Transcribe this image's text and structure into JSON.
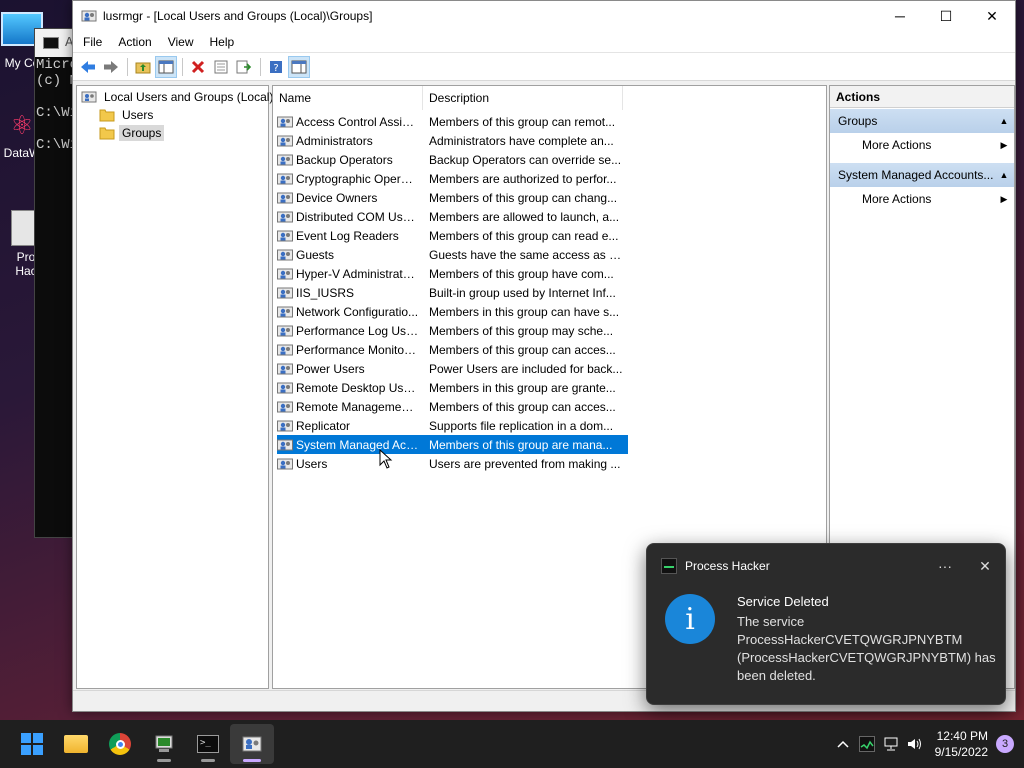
{
  "desktop": {
    "icons": [
      {
        "label": "My Co"
      },
      {
        "label": "DataW"
      },
      {
        "label": "Pro\nHac"
      }
    ]
  },
  "console": {
    "title": "A",
    "lines": [
      "Micro",
      "(c) M",
      "",
      "C:\\Wi",
      "",
      "C:\\Wi"
    ]
  },
  "window": {
    "title": "lusrmgr - [Local Users and Groups (Local)\\Groups]",
    "minimize": "─",
    "maximize": "☐",
    "close": "✕"
  },
  "menu": [
    "File",
    "Action",
    "View",
    "Help"
  ],
  "toolbar": {
    "icons": [
      "back-icon",
      "forward-icon",
      "up-folder-icon",
      "show-hide-tree-icon",
      "delete-icon",
      "properties-icon",
      "export-icon",
      "help-icon",
      "action-pane-icon"
    ]
  },
  "tree": {
    "root": "Local Users and Groups (Local)",
    "children": [
      "Users",
      "Groups"
    ],
    "selected": "Groups"
  },
  "list": {
    "columns": [
      "Name",
      "Description"
    ],
    "rows": [
      {
        "name": "Access Control Assist...",
        "desc": "Members of this group can remot..."
      },
      {
        "name": "Administrators",
        "desc": "Administrators have complete an..."
      },
      {
        "name": "Backup Operators",
        "desc": "Backup Operators can override se..."
      },
      {
        "name": "Cryptographic Operat...",
        "desc": "Members are authorized to perfor..."
      },
      {
        "name": "Device Owners",
        "desc": "Members of this group can chang..."
      },
      {
        "name": "Distributed COM Users",
        "desc": "Members are allowed to launch, a..."
      },
      {
        "name": "Event Log Readers",
        "desc": "Members of this group can read e..."
      },
      {
        "name": "Guests",
        "desc": "Guests have the same access as m..."
      },
      {
        "name": "Hyper-V Administrators",
        "desc": "Members of this group have com..."
      },
      {
        "name": "IIS_IUSRS",
        "desc": "Built-in group used by Internet Inf..."
      },
      {
        "name": "Network Configuratio...",
        "desc": "Members in this group can have s..."
      },
      {
        "name": "Performance Log Users",
        "desc": "Members of this group may sche..."
      },
      {
        "name": "Performance Monitor ...",
        "desc": "Members of this group can acces..."
      },
      {
        "name": "Power Users",
        "desc": "Power Users are included for back..."
      },
      {
        "name": "Remote Desktop Users",
        "desc": "Members in this group are grante..."
      },
      {
        "name": "Remote Management...",
        "desc": "Members of this group can acces..."
      },
      {
        "name": "Replicator",
        "desc": "Supports file replication in a dom..."
      },
      {
        "name": "System Managed Acc...",
        "desc": "Members of this group are mana..."
      },
      {
        "name": "Users",
        "desc": "Users are prevented from making ..."
      }
    ],
    "selected_index": 17
  },
  "actions": {
    "header": "Actions",
    "sections": [
      {
        "title": "Groups",
        "items": [
          "More Actions"
        ]
      },
      {
        "title": "System Managed Accounts...",
        "items": [
          "More Actions"
        ]
      }
    ]
  },
  "toast": {
    "app": "Process Hacker",
    "more": "···",
    "close": "✕",
    "icon": "i",
    "title": "Service Deleted",
    "message": "The service ProcessHackerCVETQWGRJPNYBTM (ProcessHackerCVETQWGRJPNYBTM) has been deleted."
  },
  "taskbar": {
    "apps": [
      "start",
      "file-explorer",
      "chrome",
      "computer-management",
      "terminal",
      "lusrmgr"
    ],
    "active_app": "lusrmgr",
    "tray": {
      "time": "12:40 PM",
      "date": "9/15/2022",
      "notifications": "3"
    }
  }
}
